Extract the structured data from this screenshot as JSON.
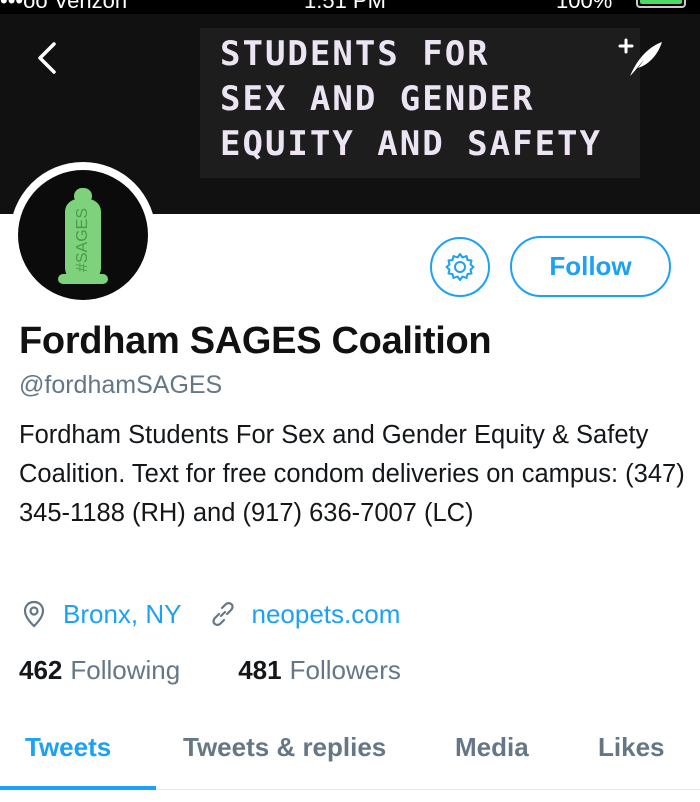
{
  "status_bar": {
    "carrier": "•••oo Verizon",
    "time": "1:51 PM",
    "battery": "100%"
  },
  "header": {
    "banner_text": "STUDENTS FOR\nSEX AND GENDER\nEQUITY AND SAFETY",
    "back_icon": "chevron-left-icon",
    "compose_icon": "compose-tweet-icon"
  },
  "avatar": {
    "label": "#SAGES",
    "colors": {
      "background": "#0b0b0b",
      "condom": "#7ed27b"
    }
  },
  "actions": {
    "settings_icon": "gear-icon",
    "follow_label": "Follow"
  },
  "profile": {
    "name": "Fordham SAGES Coalition",
    "handle": "@fordhamSAGES",
    "bio": "Fordham Students For Sex and Gender Equity & Safety Coalition. Text for free condom deliveries on campus: (347) 345-1188 (RH) and (917) 636-7007 (LC)",
    "location": "Bronx, NY",
    "website": "neopets.com"
  },
  "stats": {
    "following_count": "462",
    "following_label": "Following",
    "followers_count": "481",
    "followers_label": "Followers"
  },
  "tabs": [
    "Tweets",
    "Tweets & replies",
    "Media",
    "Likes"
  ],
  "active_tab": "Tweets",
  "colors": {
    "accent": "#1da1f2",
    "text": "#14171a",
    "secondary": "#657786",
    "banner": "#111111"
  }
}
